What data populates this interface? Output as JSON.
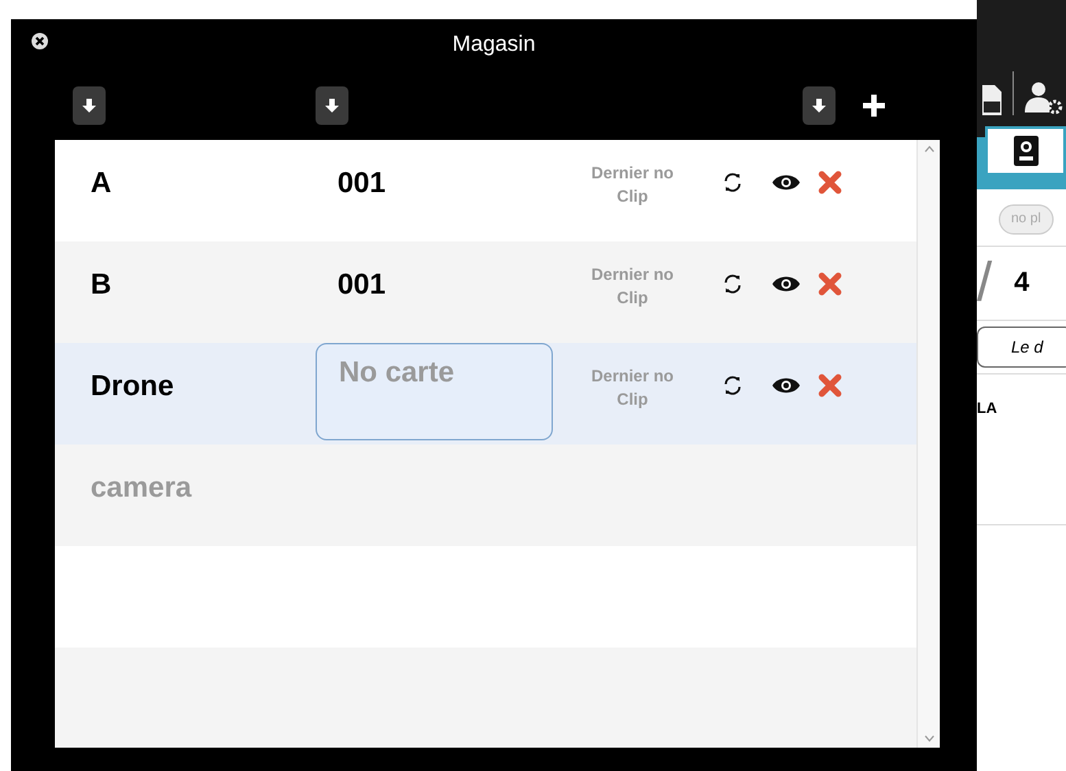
{
  "dialog": {
    "title": "Magasin"
  },
  "rows": [
    {
      "name": "A",
      "card": {
        "kind": "text",
        "text": "001"
      },
      "clip_placeholder": "Dernier no Clip",
      "selected": false
    },
    {
      "name": "B",
      "card": {
        "kind": "text",
        "text": "001"
      },
      "clip_placeholder": "Dernier no Clip",
      "selected": false
    },
    {
      "name": "Drone",
      "card": {
        "kind": "input",
        "placeholder": "No carte"
      },
      "clip_placeholder": "Dernier no Clip",
      "selected": true
    }
  ],
  "new_row": {
    "placeholder": "camera"
  },
  "background": {
    "pill": "no pl",
    "slash": "/",
    "count": "4",
    "button": "Le d",
    "label": "LA"
  }
}
